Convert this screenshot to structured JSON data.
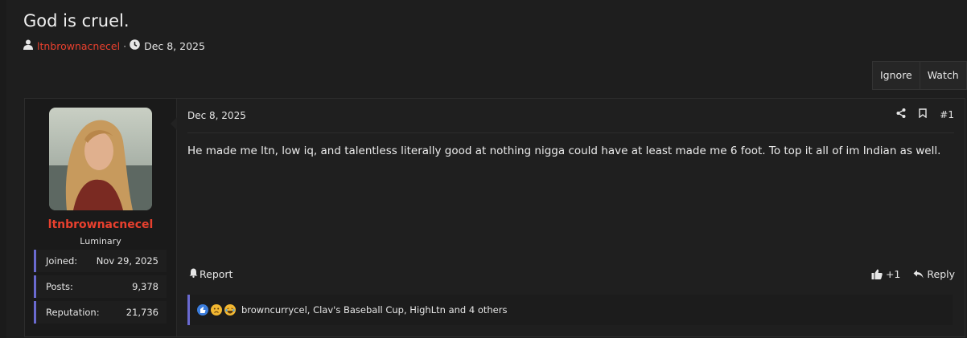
{
  "thread": {
    "title": "God is cruel.",
    "author": "ltnbrownacnecel",
    "separator": "·",
    "date": "Dec 8, 2025"
  },
  "thread_buttons": {
    "ignore": "Ignore",
    "watch": "Watch"
  },
  "post": {
    "user": {
      "name": "ltnbrownacnecel",
      "title": "Luminary",
      "stats": [
        {
          "label": "Joined:",
          "value": "Nov 29, 2025"
        },
        {
          "label": "Posts:",
          "value": "9,378"
        },
        {
          "label": "Reputation:",
          "value": "21,736"
        }
      ]
    },
    "date": "Dec 8, 2025",
    "number": "#1",
    "body": "He made me ltn, low iq, and talentless literally good at nothing nigga could have at least made me 6 foot. To top it all of im Indian as well.",
    "report_label": "Report",
    "like_label": "+1",
    "reply_label": "Reply",
    "reactions_text": "browncurrycel, Clav's Baseball Cup, HighLtn and 4 others"
  },
  "colors": {
    "accent": "#e8402e",
    "stat_border": "#6a6ad0",
    "background": "#1e1e1e"
  },
  "icons": [
    "user-icon",
    "clock-icon",
    "share-icon",
    "bookmark-icon",
    "bell-icon",
    "thumbs-up-icon",
    "reply-icon",
    "like-reaction-icon",
    "sad-reaction-icon",
    "laugh-reaction-icon"
  ]
}
